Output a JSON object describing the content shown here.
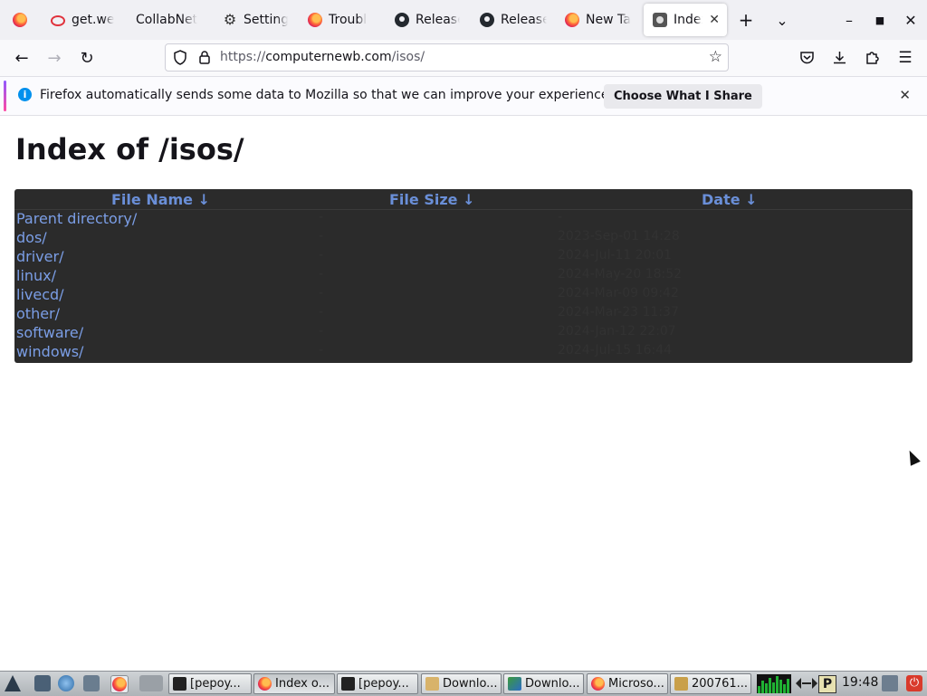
{
  "tabs": [
    {
      "label": "",
      "icon": "firefox-icon"
    },
    {
      "label": "get.we",
      "icon": "oracle-ring-icon"
    },
    {
      "label": "CollabNet",
      "icon": ""
    },
    {
      "label": "Setting",
      "icon": "gear-icon"
    },
    {
      "label": "Troubl",
      "icon": "firefox-icon"
    },
    {
      "label": "Release",
      "icon": "github-icon"
    },
    {
      "label": "Release",
      "icon": "github-icon"
    },
    {
      "label": "New Ta",
      "icon": "firefox-icon"
    },
    {
      "label": "Index",
      "icon": "disk-icon",
      "active": true
    }
  ],
  "nav": {
    "url_scheme": "https://",
    "url_host": "computernewb.com",
    "url_path": "/isos/"
  },
  "notification": {
    "message": "Firefox automatically sends some data to Mozilla so that we can improve your experience.",
    "button": "Choose What I Share"
  },
  "page": {
    "title": "Index of /isos/",
    "columns": {
      "name": "File Name  ↓",
      "size": "File Size  ↓",
      "date": "Date  ↓"
    },
    "rows": [
      {
        "name": "Parent directory/",
        "size": "-",
        "date": "-"
      },
      {
        "name": "dos/",
        "size": "-",
        "date": "2023-Sep-01 14:28"
      },
      {
        "name": "driver/",
        "size": "-",
        "date": "2024-Jul-11 20:01"
      },
      {
        "name": "linux/",
        "size": "-",
        "date": "2024-May-20 18:52"
      },
      {
        "name": "livecd/",
        "size": "-",
        "date": "2024-Mar-09 09:42"
      },
      {
        "name": "other/",
        "size": "-",
        "date": "2024-Mar-23 11:37"
      },
      {
        "name": "software/",
        "size": "-",
        "date": "2024-Jan-12 22:07"
      },
      {
        "name": "windows/",
        "size": "-",
        "date": "2024-Jul-15 16:44"
      }
    ]
  },
  "taskbar": {
    "tasks": [
      {
        "label": "[pepoy..."
      },
      {
        "label": "Index o..."
      },
      {
        "label": "[pepoy..."
      },
      {
        "label": "Downlo..."
      },
      {
        "label": "Downlo..."
      },
      {
        "label": "Microso..."
      },
      {
        "label": "200761..."
      }
    ],
    "clock": "19:48",
    "tray_letter": "P"
  },
  "colors": {
    "accent_link": "#7b9ee6",
    "header_link": "#6a8fd8",
    "listing_bg": "#2b2b2b",
    "info_blue": "#0090ed"
  }
}
